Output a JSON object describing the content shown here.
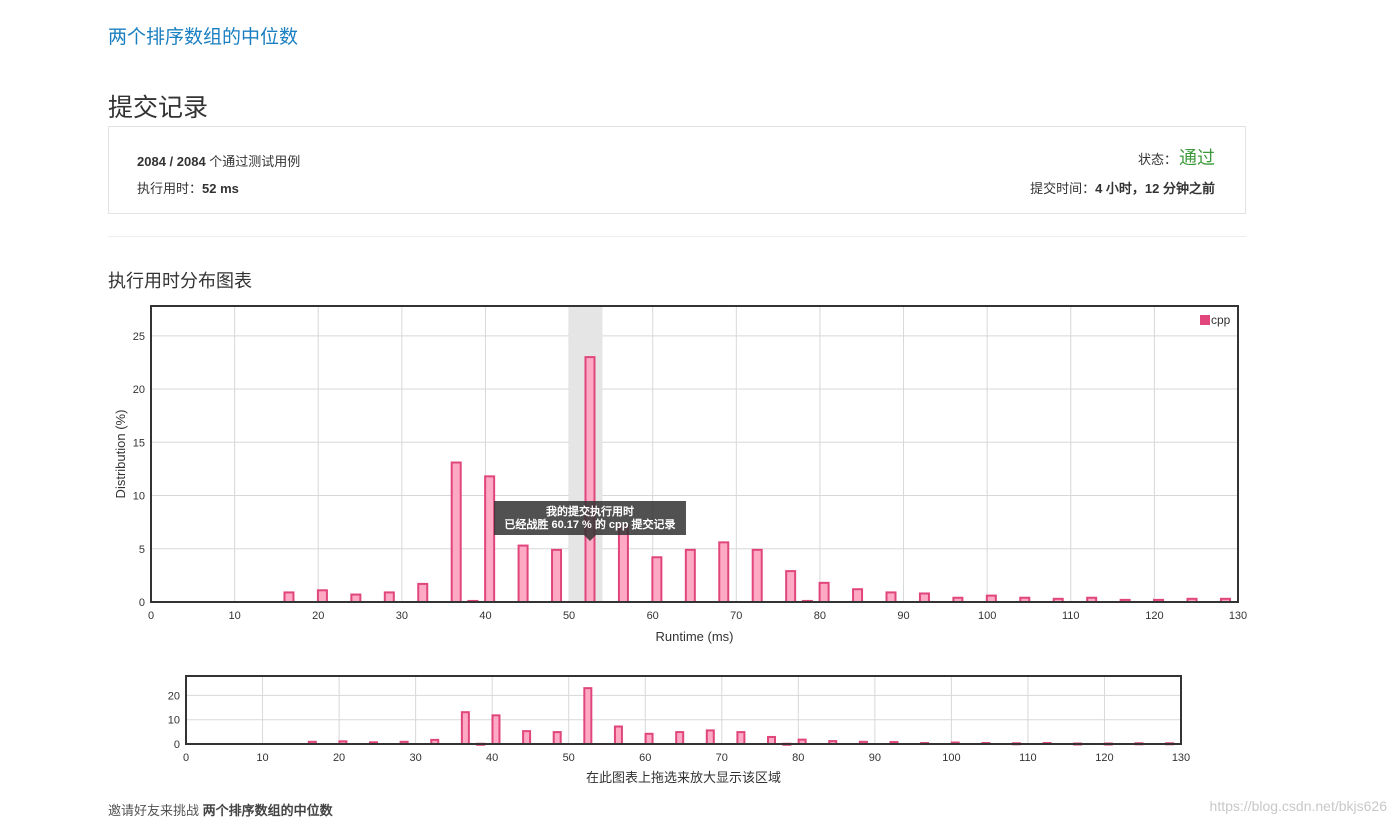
{
  "header": {
    "problem_link": "两个排序数组的中位数",
    "title": "提交记录"
  },
  "result": {
    "passed": "2084",
    "sep": " / ",
    "total": "2084",
    "cases_suffix": " 个通过测试用例",
    "runtime_label": "执行用时：",
    "runtime_value": "52 ms",
    "status_label": "状态：",
    "status_value": "通过",
    "submit_label": "提交时间：",
    "submit_value": "4 小时，12 分钟之前"
  },
  "section_title": "执行用时分布图表",
  "tooltip": {
    "line1": "我的提交执行用时",
    "line2": "已经战胜 60.17 % 的 cpp 提交记录"
  },
  "navigator_caption": "在此图表上拖选来放大显示该区域",
  "footer": {
    "prefix": "邀请好友来挑战 ",
    "problem": "两个排序数组的中位数"
  },
  "watermark": "https://blog.csdn.net/bkjs626",
  "colors": {
    "bar_fill": "#ffaac5",
    "bar_stroke": "#e0457b",
    "link": "#1a7fc1",
    "status_ok": "#3c9a3a",
    "highlight_band": "#e5e5e5"
  },
  "chart_data": {
    "type": "bar",
    "legend": [
      "cpp"
    ],
    "legend_position": "top-right",
    "xlabel": "Runtime (ms)",
    "ylabel": "Distribution (%)",
    "xlim": [
      0,
      130
    ],
    "ylim": [
      0,
      27.8
    ],
    "x_ticks": [
      0,
      10,
      20,
      30,
      40,
      50,
      60,
      70,
      80,
      90,
      100,
      110,
      120,
      130
    ],
    "y_ticks": [
      0,
      5,
      10,
      15,
      20,
      25
    ],
    "grid": true,
    "highlight_range": [
      50,
      54
    ],
    "my_runtime": 52,
    "series": [
      {
        "name": "cpp",
        "x": [
          16,
          20,
          24,
          28,
          32,
          36,
          38,
          40,
          44,
          48,
          52,
          56,
          60,
          64,
          68,
          72,
          76,
          78,
          80,
          84,
          88,
          92,
          96,
          100,
          104,
          108,
          112,
          116,
          120,
          124,
          128
        ],
        "values": [
          0.9,
          1.1,
          0.7,
          0.9,
          1.7,
          13.1,
          0.1,
          11.8,
          5.3,
          4.9,
          23.0,
          7.2,
          4.2,
          4.9,
          5.6,
          4.9,
          2.9,
          0.1,
          1.8,
          1.2,
          0.9,
          0.8,
          0.4,
          0.6,
          0.4,
          0.3,
          0.4,
          0.2,
          0.2,
          0.3,
          0.3
        ]
      }
    ],
    "navigator": {
      "xlim": [
        0,
        130
      ],
      "ylim": [
        0,
        28
      ],
      "x_ticks": [
        0,
        10,
        20,
        30,
        40,
        50,
        60,
        70,
        80,
        90,
        100,
        110,
        120,
        130
      ],
      "y_ticks": [
        0,
        10,
        20
      ]
    }
  }
}
